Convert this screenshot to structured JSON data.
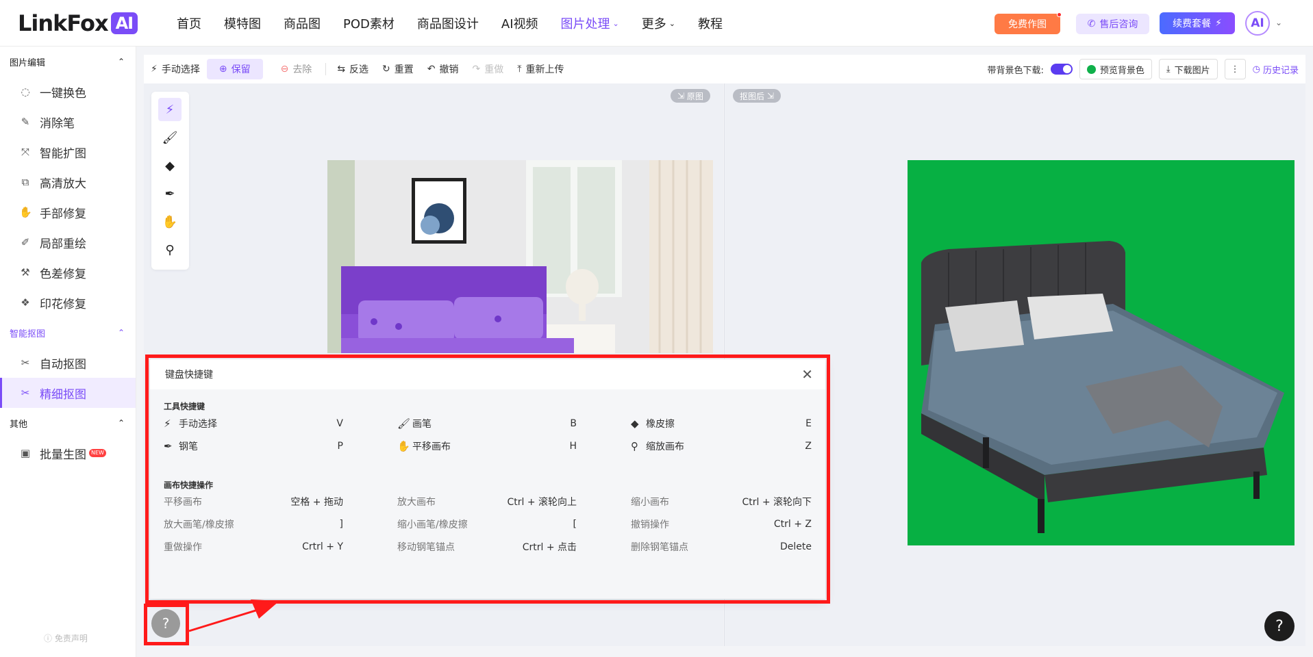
{
  "header": {
    "logo_text": "LinkFox",
    "logo_badge": "AI",
    "nav": [
      {
        "label": "首页",
        "active": false,
        "caret": false
      },
      {
        "label": "模特图",
        "active": false,
        "caret": false
      },
      {
        "label": "商品图",
        "active": false,
        "caret": false
      },
      {
        "label": "POD素材",
        "active": false,
        "caret": false
      },
      {
        "label": "商品图设计",
        "active": false,
        "caret": false
      },
      {
        "label": "AI视频",
        "active": false,
        "caret": false
      },
      {
        "label": "图片处理",
        "active": true,
        "caret": true
      },
      {
        "label": "更多",
        "active": false,
        "caret": true
      },
      {
        "label": "教程",
        "active": false,
        "caret": false
      }
    ],
    "free_button": "免费作图",
    "support_button": "售后咨询",
    "renew_button": "续费套餐",
    "avatar_text": "AI"
  },
  "sidebar": {
    "groups": [
      {
        "title": "图片编辑",
        "items": [
          {
            "label": "一键换色",
            "icon": "palette-icon",
            "glyph": "◌"
          },
          {
            "label": "消除笔",
            "icon": "eraser-pen-icon",
            "glyph": "✎"
          },
          {
            "label": "智能扩图",
            "icon": "expand-icon",
            "glyph": "⤧"
          },
          {
            "label": "高清放大",
            "icon": "upscale-icon",
            "glyph": "⧉"
          },
          {
            "label": "手部修复",
            "icon": "hand-icon",
            "glyph": "✋"
          },
          {
            "label": "局部重绘",
            "icon": "repaint-icon",
            "glyph": "✐"
          },
          {
            "label": "色差修复",
            "icon": "color-fix-icon",
            "glyph": "⚒"
          },
          {
            "label": "印花修复",
            "icon": "print-fix-icon",
            "glyph": "❖"
          }
        ]
      },
      {
        "title": "智能抠图",
        "items": [
          {
            "label": "自动抠图",
            "icon": "auto-cutout-icon",
            "glyph": "✂"
          },
          {
            "label": "精细抠图",
            "icon": "fine-cutout-icon",
            "glyph": "✂"
          }
        ]
      },
      {
        "title": "其他",
        "items": [
          {
            "label": "批量生图",
            "icon": "batch-image-icon",
            "glyph": "▣"
          }
        ]
      }
    ],
    "new_tag": "NEW",
    "disclaimer": "免责声明"
  },
  "toolbar": {
    "manual_select": "手动选择",
    "keep": "保留",
    "remove": "去除",
    "invert": "反选",
    "reset": "重置",
    "undo": "撤销",
    "redo": "重做",
    "reupload": "重新上传",
    "bg_download_label": "带背景色下载:",
    "preview_bg": "预览背景色",
    "download": "下载图片",
    "more": "⋮",
    "history": "历史记录"
  },
  "canvas": {
    "original_tag": "原图",
    "result_tag": "抠图后",
    "result_bg_color": "#07b043"
  },
  "shortcuts": {
    "title": "键盘快捷键",
    "tool_section": "工具快捷键",
    "tools": [
      [
        {
          "label": "手动选择",
          "key": "V",
          "icon": "magic-wand-icon",
          "glyph": "⚡"
        },
        {
          "label": "画笔",
          "key": "B",
          "icon": "brush-icon",
          "glyph": "🖌"
        },
        {
          "label": "橡皮擦",
          "key": "E",
          "icon": "eraser-icon",
          "glyph": "◆"
        }
      ],
      [
        {
          "label": "钢笔",
          "key": "P",
          "icon": "pen-icon",
          "glyph": "✒"
        },
        {
          "label": "平移画布",
          "key": "H",
          "icon": "hand-icon",
          "glyph": "✋"
        },
        {
          "label": "缩放画布",
          "key": "Z",
          "icon": "zoom-icon",
          "glyph": "⚲"
        }
      ]
    ],
    "canvas_section": "画布快捷操作",
    "operations": [
      [
        {
          "label": "平移画布",
          "key": "空格 + 拖动"
        },
        {
          "label": "放大画布",
          "key": "Ctrl + 滚轮向上"
        },
        {
          "label": "缩小画布",
          "key": "Ctrl + 滚轮向下"
        }
      ],
      [
        {
          "label": "放大画笔/橡皮擦",
          "key": "]"
        },
        {
          "label": "缩小画笔/橡皮擦",
          "key": "["
        },
        {
          "label": "撤销操作",
          "key": "Ctrl + Z"
        }
      ],
      [
        {
          "label": "重做操作",
          "key": "Crtrl + Y"
        },
        {
          "label": "移动钢笔锚点",
          "key": "Crtrl + 点击"
        },
        {
          "label": "删除钢笔锚点",
          "key": "Delete"
        }
      ]
    ]
  },
  "help_small": "?",
  "help_big": "?",
  "highlight_color": "#ff1a1a",
  "accent_color": "#7a4cf7"
}
